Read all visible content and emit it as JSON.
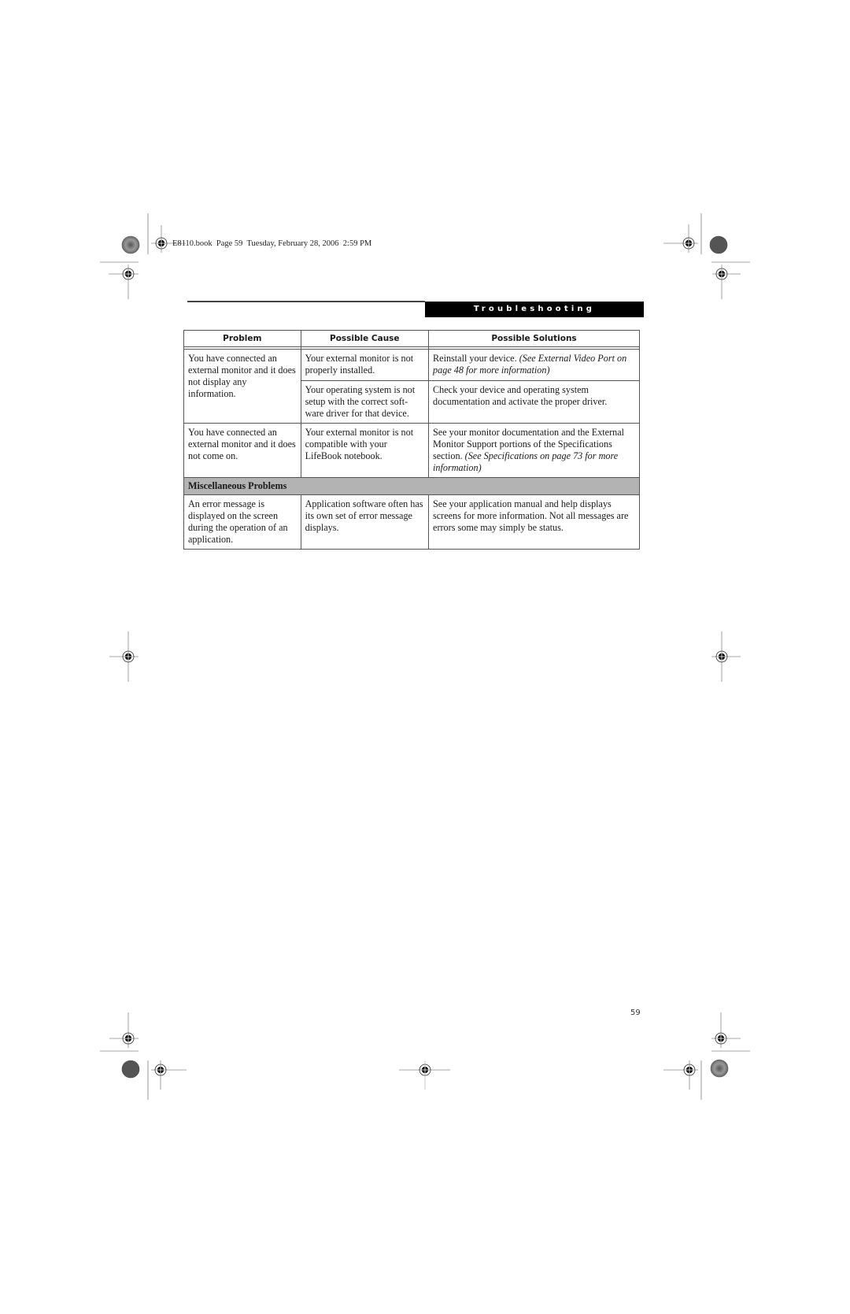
{
  "slug": "E8110.book  Page 59  Tuesday, February 28, 2006  2:59 PM",
  "section_title": "Troubleshooting",
  "table": {
    "headers": [
      "Problem",
      "Possible Cause",
      "Possible Solutions"
    ],
    "groups": [
      {
        "problem": "You have connected an external monitor and it does not display any information.",
        "rows": [
          {
            "cause": "Your external monitor is not properly installed.",
            "solution": "Reinstall your device.",
            "solution_ref": "(See External Video Port on page 48 for more information)"
          },
          {
            "cause": "Your operating system is not setup with the correct soft-ware driver for that device.",
            "solution": "Check your device and operating system documentation and activate the proper driver.",
            "solution_ref": ""
          }
        ]
      },
      {
        "problem": "You have connected an external monitor and it does not come on.",
        "rows": [
          {
            "cause": "Your external monitor is not compatible with your LifeBook notebook.",
            "solution": "See your monitor documentation and the External Monitor Support portions of the Specifications section.",
            "solution_ref": "(See Specifications on page 73 for more information)"
          }
        ]
      }
    ],
    "section_row": "Miscellaneous Problems",
    "misc": {
      "problem": "An error message is displayed on the screen during the operation of an application.",
      "cause": "Application software often has its own set of error message displays.",
      "solution": "See your application manual and help displays screens for more information. Not all messages are errors some may simply be status."
    }
  },
  "page_number": "59",
  "colors": {
    "section_bar_bg": "#000000",
    "section_row_bg": "#b3b3b3"
  }
}
